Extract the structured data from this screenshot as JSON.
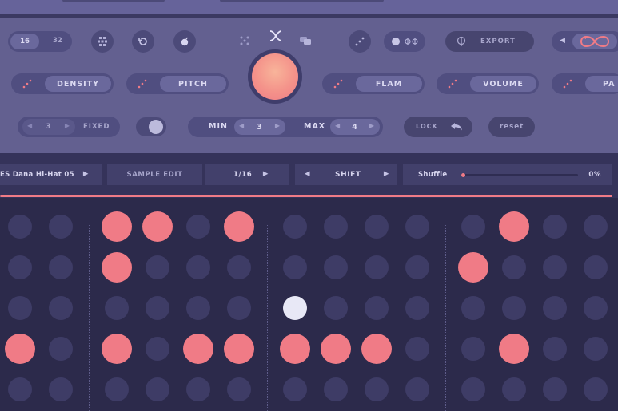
{
  "header": {
    "step_options": [
      "16",
      "32"
    ],
    "export_label": "EXPORT"
  },
  "controls": {
    "density_label": "DENSITY",
    "pitch_label": "PITCH",
    "flam_label": "FLAM",
    "volume_label": "VOLUME",
    "partial_label": "PA",
    "fixed_value": "3",
    "fixed_label": "FIXED",
    "min_label": "MIN",
    "min_value": "3",
    "max_label": "MAX",
    "max_value": "4",
    "lock_label": "LOCK",
    "reset_label": "reset"
  },
  "track_bar": {
    "sample_name": "ES Dana Hi-Hat 05",
    "sample_edit_label": "SAMPLE EDIT",
    "division": "1/16",
    "shift_label": "SHIFT",
    "shuffle_label": "Shuffle",
    "shuffle_value": "0%"
  },
  "colors": {
    "accent": "#f07b86",
    "active_step": "#f07b86",
    "playhead_step": "#e8e8f6",
    "inactive_step": "#3e3c66"
  },
  "sequencer": {
    "rows": [
      [
        0,
        0,
        1,
        1,
        0,
        1,
        0,
        0,
        0,
        0,
        0,
        1,
        0,
        0
      ],
      [
        0,
        0,
        1,
        0,
        0,
        0,
        0,
        0,
        0,
        0,
        1,
        0,
        0,
        0
      ],
      [
        0,
        0,
        0,
        0,
        0,
        0,
        2,
        0,
        0,
        0,
        0,
        0,
        0,
        0
      ],
      [
        1,
        0,
        1,
        0,
        1,
        1,
        1,
        1,
        1,
        0,
        0,
        1,
        0,
        0
      ],
      [
        0,
        0,
        0,
        0,
        0,
        0,
        0,
        0,
        0,
        0,
        0,
        0,
        0,
        0
      ]
    ]
  }
}
